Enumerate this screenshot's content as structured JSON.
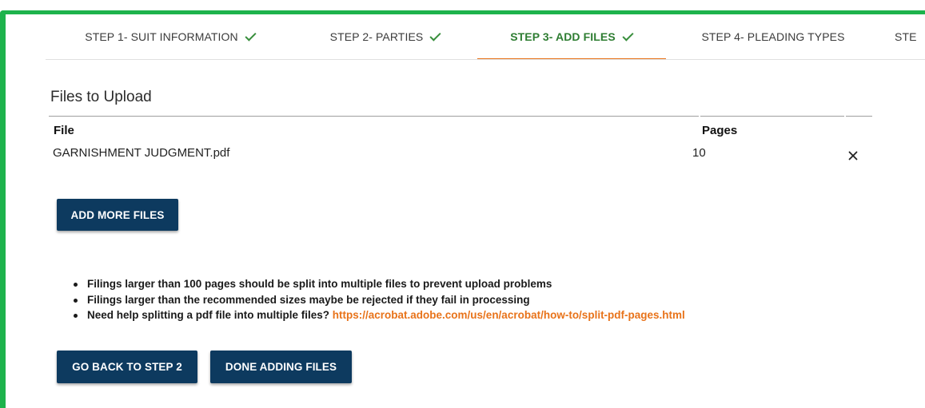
{
  "stepper": {
    "steps": [
      {
        "label": "STEP 1- SUIT INFORMATION",
        "completed": true,
        "active": false
      },
      {
        "label": "STEP 2- PARTIES",
        "completed": true,
        "active": false
      },
      {
        "label": "STEP 3- ADD FILES",
        "completed": true,
        "active": true
      },
      {
        "label": "STEP 4- PLEADING TYPES",
        "completed": false,
        "active": false
      },
      {
        "label": "STE",
        "completed": false,
        "active": false
      }
    ]
  },
  "files": {
    "title": "Files to Upload",
    "columns": {
      "file": "File",
      "pages": "Pages"
    },
    "rows": [
      {
        "file": "GARNISHMENT JUDGMENT.pdf",
        "pages": "10"
      }
    ],
    "remove_icon": "close-icon",
    "add_more_label": "ADD MORE FILES"
  },
  "notes": {
    "items": [
      "Filings larger than 100 pages should be split into multiple files to prevent upload problems",
      "Filings larger than the recommended sizes maybe be rejected if they fail in processing",
      "Need help splitting a pdf file into multiple files?"
    ],
    "link_text": "https://acrobat.adobe.com/us/en/acrobat/how-to/split-pdf-pages.html"
  },
  "actions": {
    "back_label": "GO BACK TO STEP 2",
    "done_label": "DONE ADDING FILES"
  },
  "colors": {
    "frame": "#1db34c",
    "active_step": "#2e7d32",
    "active_underline": "#e8731a",
    "button": "#0d3a5f",
    "link": "#e8731a"
  }
}
